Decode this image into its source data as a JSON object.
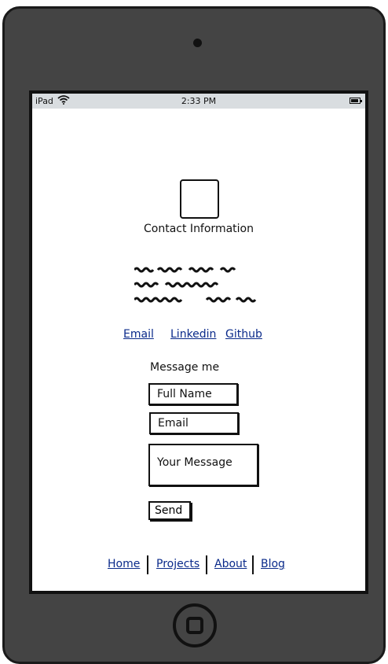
{
  "status_bar": {
    "device": "iPad",
    "time": "2:33 PM"
  },
  "contact": {
    "title": "Contact Information"
  },
  "social_links": [
    {
      "label": "Email"
    },
    {
      "label": "Linkedin"
    },
    {
      "label": "Github"
    }
  ],
  "form": {
    "heading": "Message me",
    "full_name_placeholder": "Full Name",
    "email_placeholder": "Email",
    "message_placeholder": "Your Message",
    "send_label": "Send"
  },
  "footer_nav": [
    {
      "label": "Home"
    },
    {
      "label": "Projects"
    },
    {
      "label": "About"
    },
    {
      "label": "Blog"
    }
  ],
  "colors": {
    "device_body": "#444444",
    "status_bar_bg": "#d9dde0",
    "link": "#0a2a8a"
  }
}
